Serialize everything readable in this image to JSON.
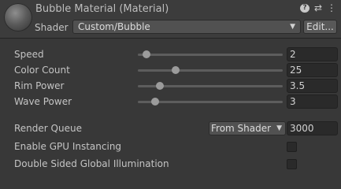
{
  "header": {
    "title": "Bubble Material (Material)",
    "shader_label": "Shader",
    "shader_value": "Custom/Bubble",
    "edit_label": "Edit...",
    "icons": [
      "help-icon",
      "settings-sliders-icon",
      "more-vert-icon"
    ]
  },
  "properties": [
    {
      "label": "Speed",
      "value": "2",
      "slider_fraction": 0.06
    },
    {
      "label": "Color Count",
      "value": "25",
      "slider_fraction": 0.26
    },
    {
      "label": "Rim Power",
      "value": "3.5",
      "slider_fraction": 0.15
    },
    {
      "label": "Wave Power",
      "value": "3",
      "slider_fraction": 0.12
    }
  ],
  "render_queue": {
    "label": "Render Queue",
    "mode": "From Shader",
    "value": "3000"
  },
  "gpu_instancing": {
    "label": "Enable GPU Instancing",
    "checked": false
  },
  "double_sided_gi": {
    "label": "Double Sided Global Illumination",
    "checked": false
  }
}
